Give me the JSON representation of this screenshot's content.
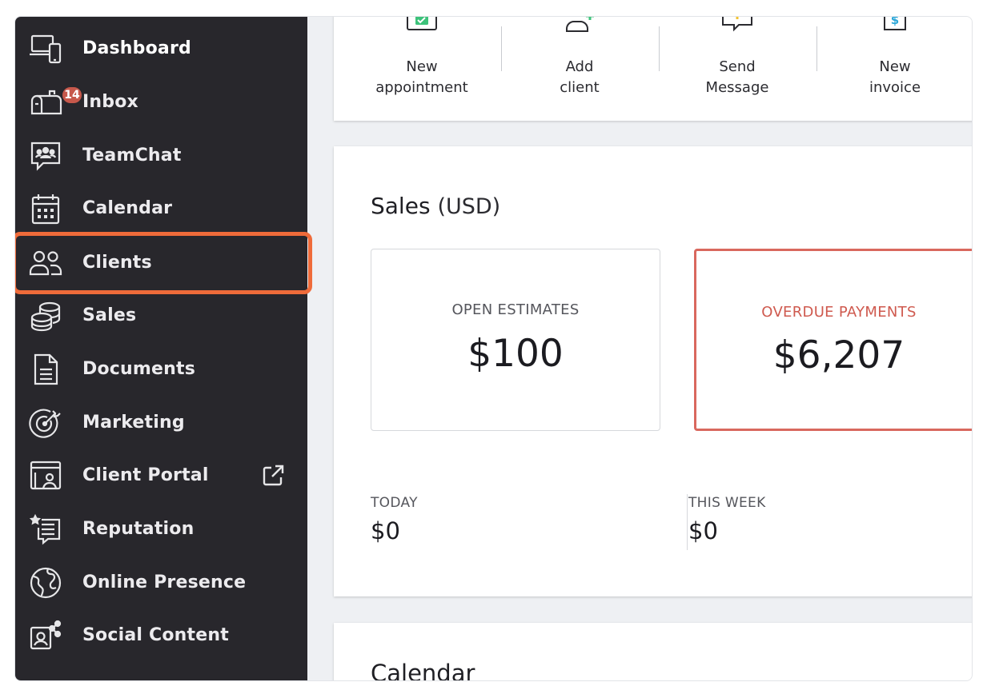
{
  "sidebar": {
    "items": [
      {
        "label": "Dashboard",
        "icon": "dashboard-devices-icon"
      },
      {
        "label": "Inbox",
        "icon": "mailbox-icon",
        "badge": "14"
      },
      {
        "label": "TeamChat",
        "icon": "team-chat-icon"
      },
      {
        "label": "Calendar",
        "icon": "calendar-icon"
      },
      {
        "label": "Clients",
        "icon": "clients-icon"
      },
      {
        "label": "Sales",
        "icon": "coins-icon"
      },
      {
        "label": "Documents",
        "icon": "document-icon"
      },
      {
        "label": "Marketing",
        "icon": "target-icon"
      },
      {
        "label": "Client Portal",
        "icon": "portal-icon",
        "trailing_icon": "external-link-icon"
      },
      {
        "label": "Reputation",
        "icon": "star-review-icon"
      },
      {
        "label": "Online Presence",
        "icon": "globe-icon"
      },
      {
        "label": "Social Content",
        "icon": "social-content-icon"
      }
    ],
    "highlighted_item": "Clients",
    "highlight_color": "#ef6b3a",
    "background": "#28272c"
  },
  "quick_actions": [
    {
      "line1": "New",
      "line2": "appointment",
      "icon": "calendar-check-icon",
      "accent": "#3cc27a"
    },
    {
      "line1": "Add",
      "line2": "client",
      "icon": "add-user-icon",
      "accent": "#3cc27a"
    },
    {
      "line1": "Send",
      "line2": "Message",
      "icon": "message-bubble-icon",
      "accent": "#f2c230"
    },
    {
      "line1": "New",
      "line2": "invoice",
      "icon": "invoice-dollar-icon",
      "accent": "#2aa6d8"
    }
  ],
  "sales": {
    "title": "Sales",
    "unit": "(USD)",
    "open_estimates": {
      "label": "OPEN ESTIMATES",
      "value": "$100"
    },
    "overdue_payments": {
      "label": "OVERDUE PAYMENTS",
      "value": "$6,207",
      "color": "#d9685e"
    },
    "today": {
      "label": "TODAY",
      "value": "$0"
    },
    "this_week": {
      "label": "THIS WEEK",
      "value": "$0"
    }
  },
  "calendar": {
    "title": "Calendar"
  }
}
